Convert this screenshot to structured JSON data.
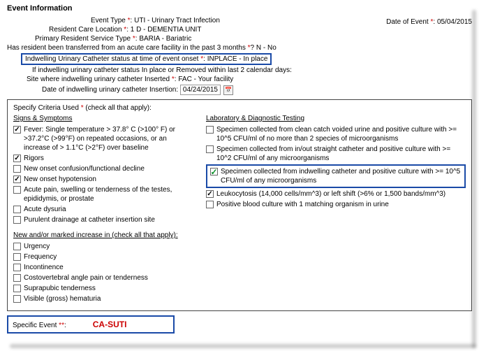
{
  "header": {
    "title": "Event Information"
  },
  "date_of_event": {
    "label": "Date of Event",
    "value": "05/04/2015"
  },
  "fields": {
    "event_type": {
      "label": "Event Type",
      "value": "UTI - Urinary Tract Infection"
    },
    "care_loc": {
      "label": "Resident Care Location",
      "value": "1 D - DEMENTIA UNIT"
    },
    "service_type": {
      "label": "Primary Resident Service Type",
      "value": "BARIA - Bariatric"
    },
    "transfer": {
      "label": "Has resident been transferred from an acute care facility in the past 3 months",
      "suffix": "?",
      "value": "N - No"
    },
    "cath_status": {
      "label": "Indwelling Urinary Catheter status at time of event onset",
      "value": "INPLACE - In place"
    },
    "removed_note": {
      "text": "If indwelling urinary catheter status In place or Removed within last 2 calendar days:"
    },
    "cath_site": {
      "label": "Site where indwelling urinary catheter Inserted",
      "value": "FAC - Your facility"
    },
    "cath_date": {
      "label": "Date of indwelling urinary catheter Insertion:",
      "value": "04/24/2015"
    }
  },
  "criteria": {
    "title_a": "Specify Criteria Used",
    "title_b": "(check all that apply):",
    "signs": {
      "head": "Signs & Symptoms",
      "items": [
        {
          "label": "Fever: Single temperature > 37.8° C (>100° F) or >37.2°C (>99°F) on repeated occasions, or an increase of > 1.1°C (>2°F) over baseline",
          "checked": true
        },
        {
          "label": "Rigors",
          "checked": true
        },
        {
          "label": "New onset confusion/functional decline",
          "checked": false
        },
        {
          "label": "New onset hypotension",
          "checked": true
        },
        {
          "label": "Acute pain, swelling or tenderness of the testes, epididymis, or prostate",
          "checked": false
        },
        {
          "label": "Acute dysuria",
          "checked": false
        },
        {
          "label": "Purulent drainage at catheter insertion site",
          "checked": false
        }
      ]
    },
    "lab": {
      "head": "Laboratory & Diagnostic Testing",
      "items": [
        {
          "label": "Specimen collected from clean catch voided urine and positive culture with >= 10^5 CFU/ml of no more than 2 species of microorganisms",
          "checked": false
        },
        {
          "label": "Specimen collected from in/out straight catheter and positive culture with >= 10^2 CFU/ml of any microorganisms",
          "checked": false
        },
        {
          "label": "Specimen collected from indwelling catheter and positive culture with >= 10^5 CFU/ml of any microorganisms",
          "checked": true,
          "hl": true
        },
        {
          "label": "Leukocytosis (14,000 cells/mm^3) or left shift (>6% or 1,500 bands/mm^3)",
          "checked": true
        },
        {
          "label": "Positive blood culture with 1 matching organism in urine",
          "checked": false
        }
      ]
    },
    "new_inc": {
      "head": "New and/or marked increase in (check all that apply):",
      "items": [
        {
          "label": "Urgency",
          "checked": false
        },
        {
          "label": "Frequency",
          "checked": false
        },
        {
          "label": "Incontinence",
          "checked": false
        },
        {
          "label": "Costovertebral angle pain or tenderness",
          "checked": false
        },
        {
          "label": "Suprapubic tenderness",
          "checked": false
        },
        {
          "label": "Visible (gross) hematuria",
          "checked": false
        }
      ]
    }
  },
  "specific": {
    "label": "Specific Event",
    "value": "CA-SUTI"
  }
}
